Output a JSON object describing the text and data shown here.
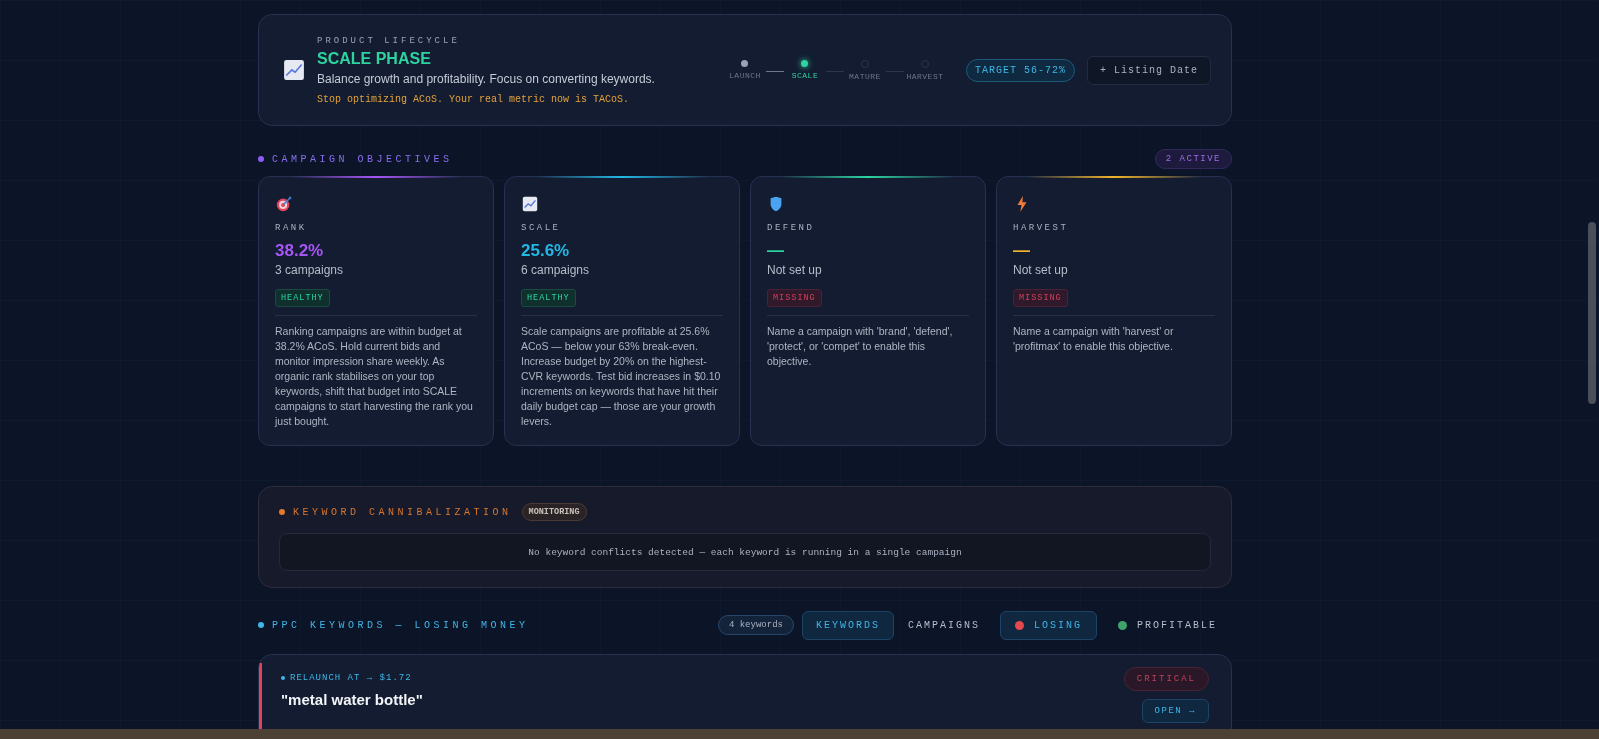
{
  "lifecycle": {
    "label": "PRODUCT LIFECYCLE",
    "title": "SCALE PHASE",
    "description": "Balance growth and profitability. Focus on converting keywords.",
    "warning": "Stop optimizing ACoS. Your real metric now is TACoS.",
    "stages": [
      {
        "label": "LAUNCH",
        "done": true,
        "current": false
      },
      {
        "label": "SCALE",
        "done": false,
        "current": true
      },
      {
        "label": "MATURE",
        "done": false,
        "current": false
      },
      {
        "label": "HARVEST",
        "done": false,
        "current": false
      }
    ],
    "target": "TARGET 56-72%",
    "listing_button": "+ Listing Date"
  },
  "objectives": {
    "title": "CAMPAIGN OBJECTIVES",
    "active_badge": "2 ACTIVE",
    "cards": [
      {
        "kind": "rank",
        "name": "RANK",
        "value": "38.2%",
        "color": "#a855f7",
        "campaigns": "3 campaigns",
        "status": "HEALTHY",
        "healthy": true,
        "description": "Ranking campaigns are within budget at 38.2% ACoS. Hold current bids and monitor impression share weekly. As organic rank stabilises on your top keywords, shift that budget into SCALE campaigns to start harvesting the rank you just bought."
      },
      {
        "kind": "scale",
        "name": "SCALE",
        "value": "25.6%",
        "color": "#22b8e6",
        "campaigns": "6 campaigns",
        "status": "HEALTHY",
        "healthy": true,
        "description": "Scale campaigns are profitable at 25.6% ACoS — below your 63% break-even. Increase budget by 20% on the highest-CVR keywords. Test bid increases in $0.10 increments on keywords that have hit their daily budget cap — those are your growth levers."
      },
      {
        "kind": "defend",
        "name": "DEFEND",
        "value": "—",
        "color": "#2dd4a0",
        "campaigns": "Not set up",
        "status": "MISSING",
        "healthy": false,
        "description": "Name a campaign with 'brand', 'defend', 'protect', or 'compet' to enable this objective."
      },
      {
        "kind": "harvest",
        "name": "HARVEST",
        "value": "—",
        "color": "#f0b429",
        "campaigns": "Not set up",
        "status": "MISSING",
        "healthy": false,
        "description": "Name a campaign with 'harvest' or 'profitmax' to enable this objective."
      }
    ]
  },
  "cannibalization": {
    "title": "KEYWORD CANNIBALIZATION",
    "badge": "MONITORING",
    "message": "No keyword conflicts detected — each keyword is running in a single campaign"
  },
  "ppc": {
    "title": "PPC KEYWORDS — LOSING MONEY",
    "count": "4 keywords",
    "tabs": [
      {
        "label": "KEYWORDS",
        "selected": true
      },
      {
        "label": "CAMPAIGNS",
        "selected": false
      }
    ],
    "filters": [
      {
        "label": "LOSING",
        "selected": true,
        "color": "#e5484d"
      },
      {
        "label": "PROFITABLE",
        "selected": false,
        "color": "#3fa46a"
      }
    ],
    "keyword": {
      "tag": "RELAUNCH AT → $1.72",
      "name": "\"metal water bottle\"",
      "badge": "CRITICAL",
      "open_button": "OPEN →"
    }
  }
}
